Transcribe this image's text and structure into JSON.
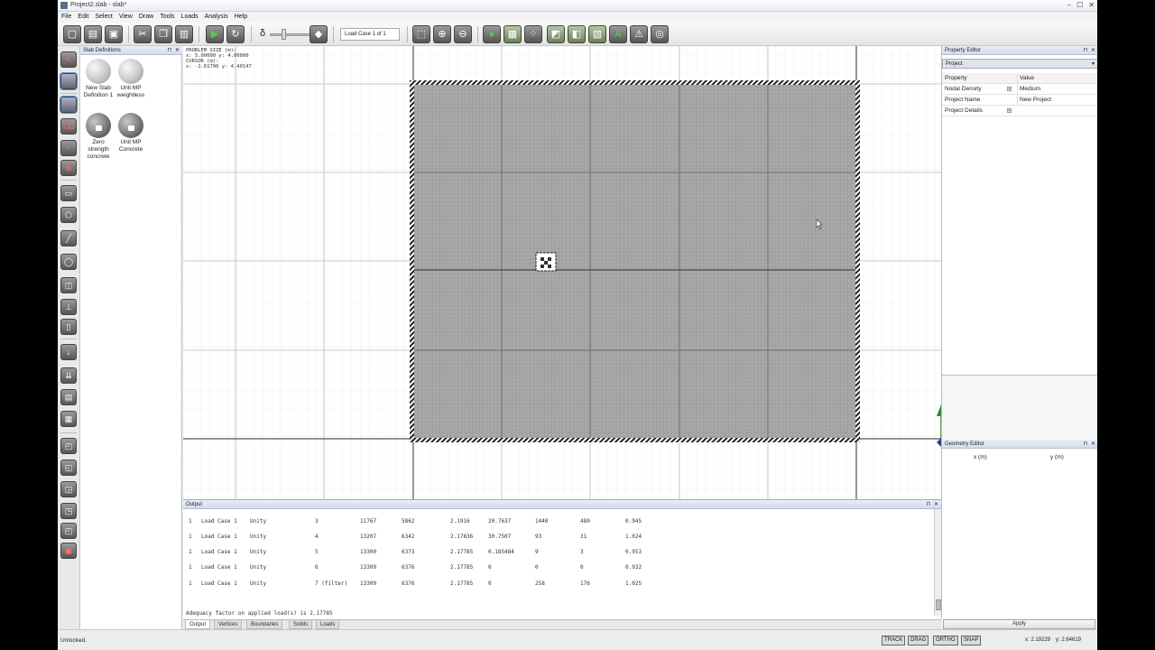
{
  "window": {
    "title": "Project2.slab - slab*",
    "controls": [
      "–",
      "☐",
      "✕"
    ]
  },
  "menu": [
    "File",
    "Edit",
    "Select",
    "View",
    "Draw",
    "Tools",
    "Loads",
    "Analysis",
    "Help"
  ],
  "toolbar": {
    "delta_symbol": "δ",
    "load_case": "Load Case 1 of 1",
    "slider_level_percent": 25
  },
  "slab_definitions": {
    "title": "Slab Definitions",
    "items": [
      {
        "label": "New Slab Definition 1",
        "locked": false
      },
      {
        "label": "Unit MP weightless",
        "locked": false
      },
      {
        "label": "Zero strength concrete",
        "locked": true
      },
      {
        "label": "Unit MP Concrete",
        "locked": true
      }
    ]
  },
  "canvas": {
    "readout_line1": "PROBLEM SIZE (m):",
    "readout_line2": "x: 5.00000 y: 4.00000",
    "readout_line3": "CURSOR (m):",
    "readout_line4": "x: -1.61796 y: 4.40147",
    "axis_x_label": "x",
    "axis_y_label": "y"
  },
  "output": {
    "title": "Output",
    "rows": [
      [
        "1",
        "Load Case 1",
        "Unity",
        "3",
        "11767",
        "5862",
        "2.1916",
        "20.7637",
        "1440",
        "480",
        "0.945"
      ],
      [
        "1",
        "Load Case 1",
        "Unity",
        "4",
        "13207",
        "6342",
        "2.17836",
        "30.7507",
        "93",
        "31",
        "1.024"
      ],
      [
        "1",
        "Load Case 1",
        "Unity",
        "5",
        "13300",
        "6373",
        "2.17785",
        "0.185484",
        "9",
        "3",
        "0.953"
      ],
      [
        "1",
        "Load Case 1",
        "Unity",
        "6",
        "13309",
        "6376",
        "2.17785",
        "0",
        "0",
        "0",
        "0.932"
      ],
      [
        "1",
        "Load Case 1",
        "Unity",
        "7 (filter)",
        "13309",
        "6376",
        "2.17785",
        "0",
        "258",
        "176",
        "1.025"
      ]
    ],
    "adequacy": "Adequacy factor on applied load(s) is 2.17785",
    "tabs": [
      "Output",
      "Vertices",
      "Boundaries",
      "Solids",
      "Loads"
    ]
  },
  "property_editor": {
    "title": "Property Editor",
    "selected": "Project",
    "col_property": "Property",
    "col_value": "Value",
    "rows": [
      {
        "name": "Nodal Density",
        "value": "Medium"
      },
      {
        "name": "Project Name",
        "value": "New Project"
      },
      {
        "name": "Project Details",
        "value": ""
      }
    ]
  },
  "geometry_editor": {
    "title": "Geometry Editor",
    "col_x": "x (m)",
    "col_y": "y (m)",
    "apply": "Apply"
  },
  "status": {
    "text": "Unlocked.",
    "modes": [
      "TRACK",
      "DRAG",
      "ORTHO",
      "SNAP"
    ],
    "x": "x: 2.19229",
    "y": "y: 2.64619"
  }
}
